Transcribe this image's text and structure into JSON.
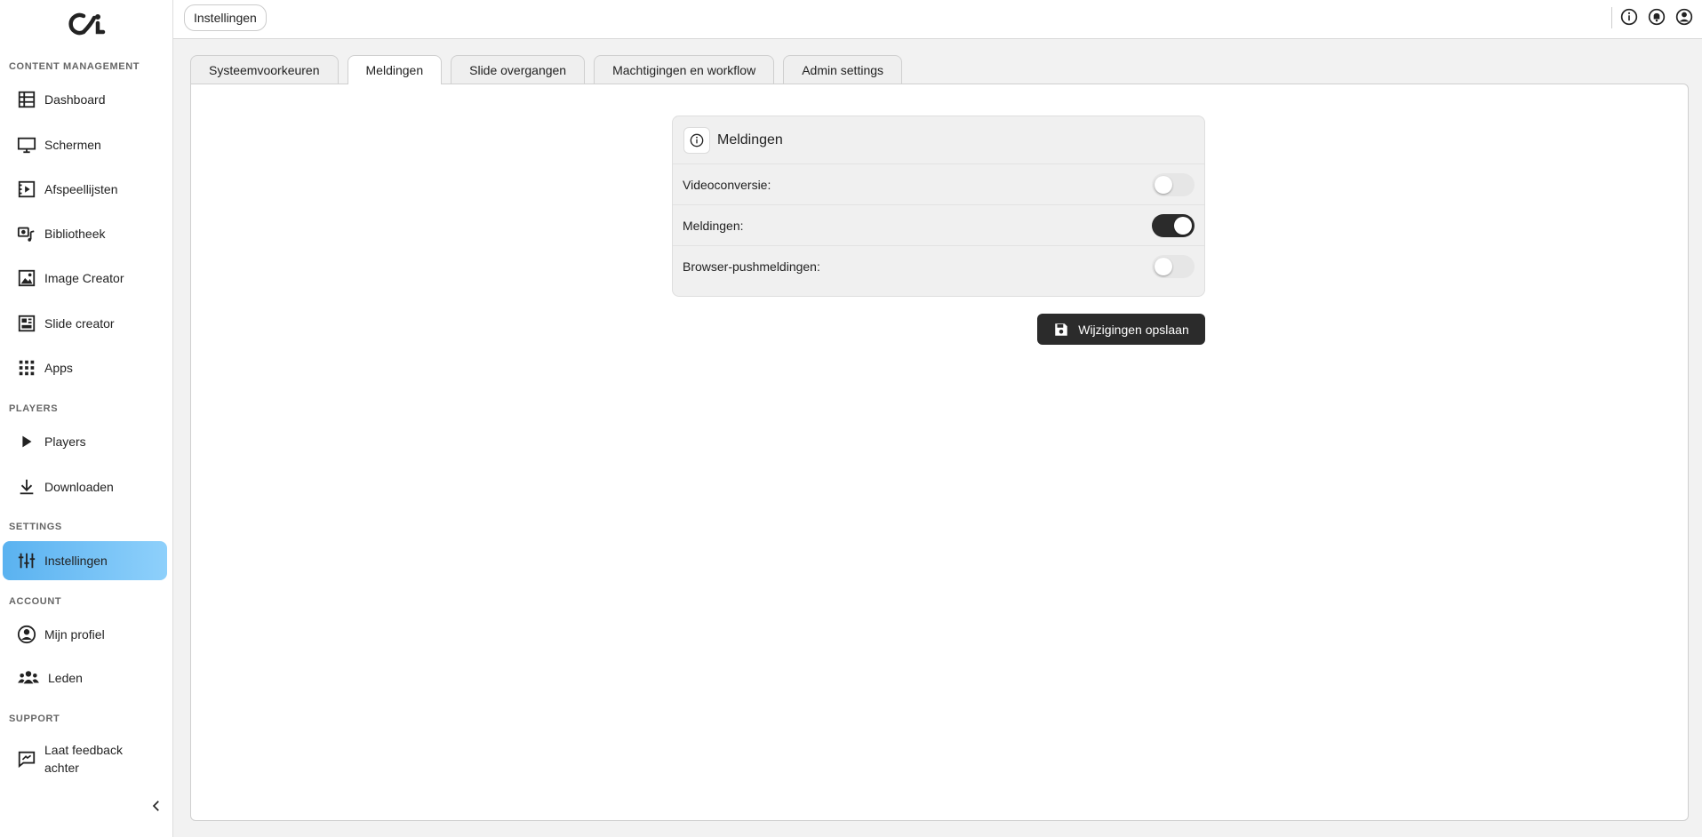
{
  "sidebar": {
    "sections": {
      "content": "CONTENT MANAGEMENT",
      "players": "PLAYERS",
      "settings": "SETTINGS",
      "account": "ACCOUNT",
      "support": "SUPPORT"
    },
    "items": {
      "dashboard": "Dashboard",
      "schermen": "Schermen",
      "afspeellijsten": "Afspeellijsten",
      "bibliotheek": "Bibliotheek",
      "image_creator": "Image Creator",
      "slide_creator": "Slide creator",
      "apps": "Apps",
      "players": "Players",
      "downloaden": "Downloaden",
      "instellingen": "Instellingen",
      "mijn_profiel": "Mijn profiel",
      "leden": "Leden",
      "feedback": "Laat feedback achter"
    }
  },
  "header": {
    "breadcrumb": "Instellingen"
  },
  "tabs": {
    "systeem": "Systeemvoorkeuren",
    "meldingen": "Meldingen",
    "slide": "Slide overgangen",
    "machtigingen": "Machtigingen en workflow",
    "admin": "Admin settings"
  },
  "card": {
    "title": "Meldingen",
    "rows": {
      "videoconversie": {
        "label": "Videoconversie:",
        "enabled": false
      },
      "meldingen": {
        "label": "Meldingen:",
        "enabled": true
      },
      "push": {
        "label": "Browser-pushmeldingen:",
        "enabled": false
      }
    }
  },
  "save_label": "Wijzigingen opslaan"
}
